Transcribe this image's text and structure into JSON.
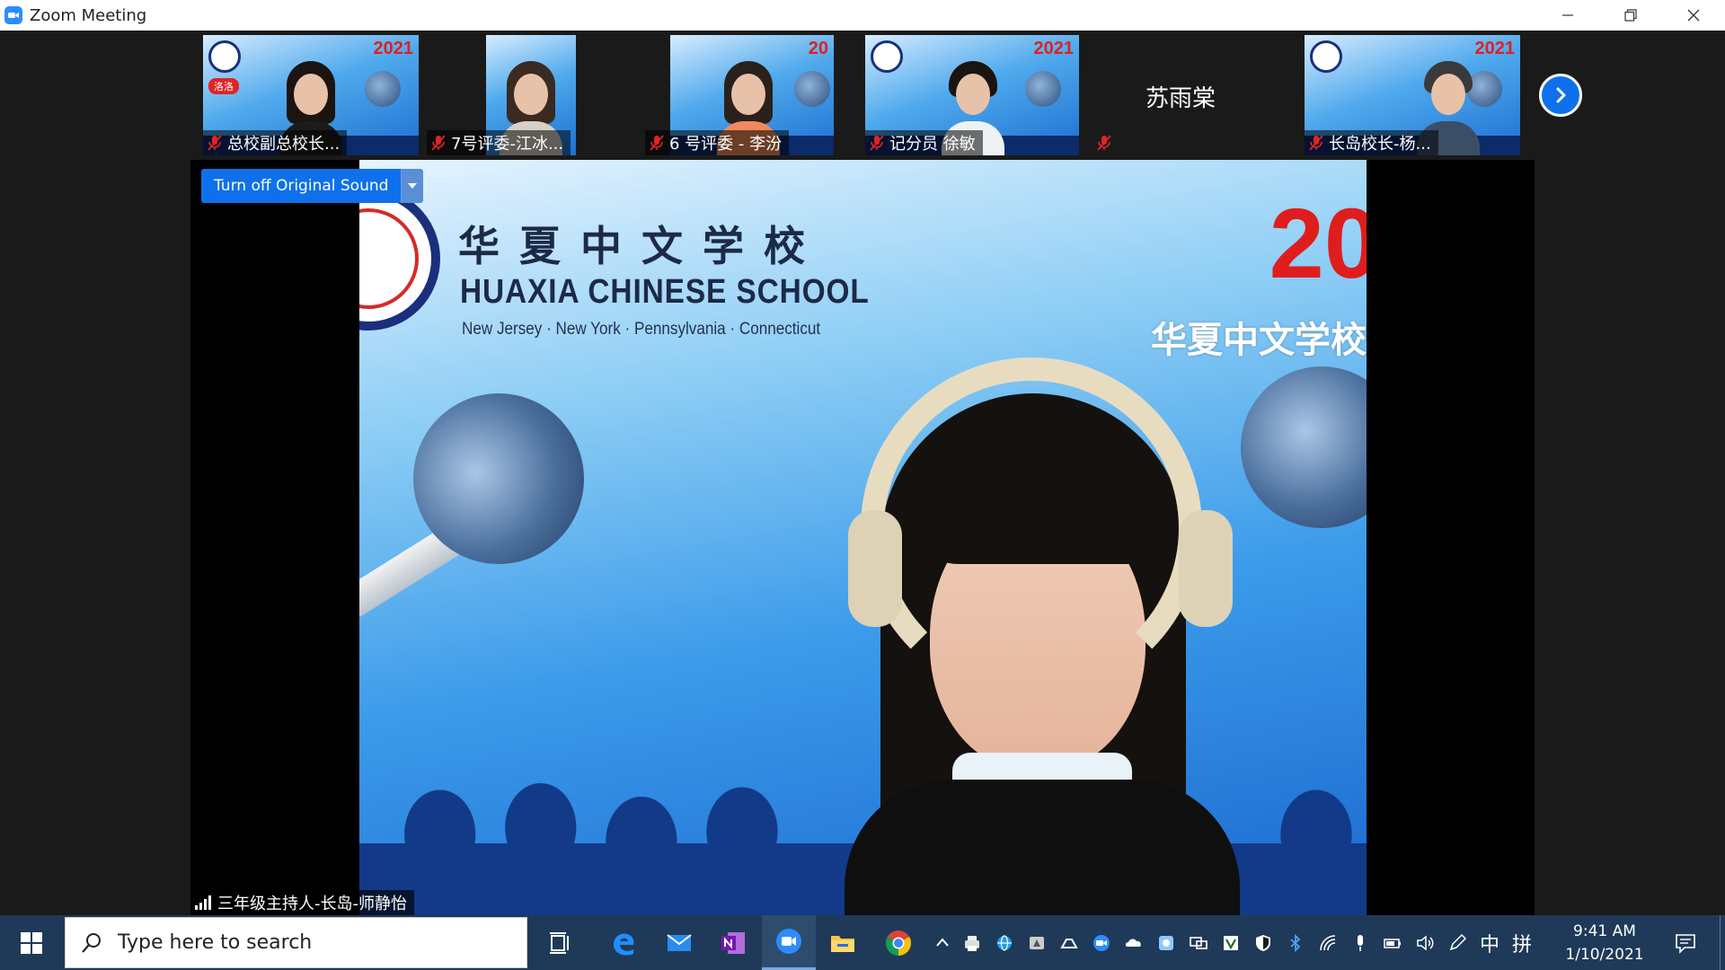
{
  "window": {
    "title": "Zoom Meeting",
    "controls": [
      "minimize-icon",
      "restore-icon",
      "close-icon"
    ]
  },
  "participants": [
    {
      "name": "总校副总校长...",
      "muted": true,
      "has_video": true,
      "badge": "洛洛"
    },
    {
      "name": "7号评委-江冰...",
      "muted": true,
      "has_video": true
    },
    {
      "name": "6 号评委 - 李汾",
      "muted": true,
      "has_video": true
    },
    {
      "name": "记分员 徐敏",
      "muted": true,
      "has_video": true
    },
    {
      "name": "苏雨棠",
      "muted": true,
      "has_video": false
    },
    {
      "name": "长岛校长-杨...",
      "muted": true,
      "has_video": true
    }
  ],
  "tile_year": "2021",
  "next_page_icon": "chevron-right-icon",
  "speaker": {
    "name": "三年级主持人-长岛-师静怡",
    "original_sound_button": "Turn off Original Sound",
    "background": {
      "school_cn": "华夏中文学校",
      "school_en": "HUAXIA CHINESE SCHOOL",
      "locations": "New Jersey · New York · Pennsylvania · Connecticut",
      "year": "20",
      "banner_cn": "华夏中文学校演"
    }
  },
  "taskbar": {
    "search_placeholder": "Type here to search",
    "pinned_apps": [
      "task-view-icon",
      "edge-icon",
      "mail-icon",
      "onenote-icon",
      "zoom-icon",
      "file-explorer-icon",
      "chrome-icon"
    ],
    "active_app": "zoom-icon",
    "tray_icons": [
      "show-hidden-icons-icon",
      "printer-icon",
      "globe-icon",
      "drive-icon",
      "google-drive-icon",
      "zoom-tray-icon",
      "onedrive-icon",
      "webcam-icon",
      "display-icon",
      "vim-icon",
      "security-shield-icon",
      "bluetooth-icon",
      "wifi-icon",
      "microphone-icon",
      "battery-icon",
      "volume-icon",
      "pen-icon"
    ],
    "ime_lang": "中",
    "ime_mode": "拼",
    "time": "9:41 AM",
    "date": "1/10/2021"
  },
  "colors": {
    "zoom_blue": "#0e71eb",
    "taskbar_bg": "#1f3a58",
    "mute_red": "#e02424",
    "year_red": "#e01d1d"
  }
}
